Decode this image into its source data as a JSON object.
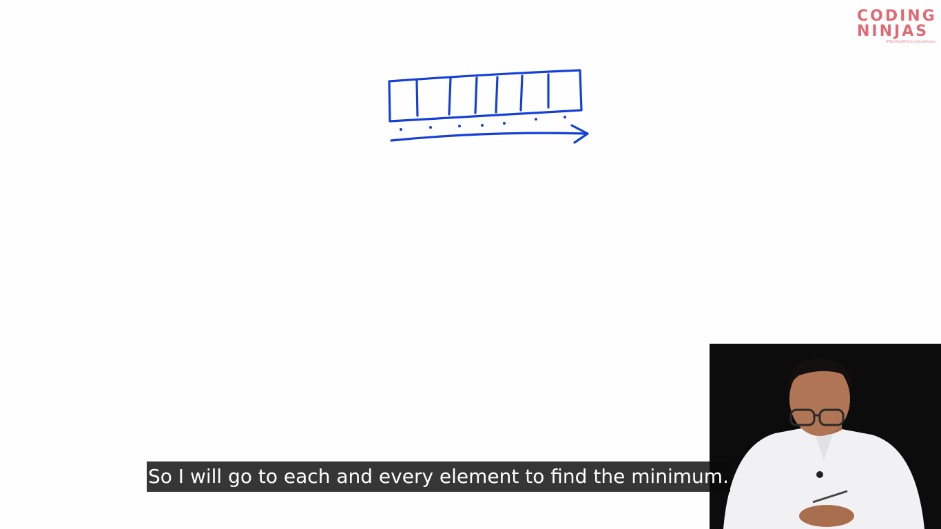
{
  "logo": {
    "line1": "CODING",
    "line2": "NINJAS",
    "tagline": "#SkillUpWithCodingNinjas",
    "color": "#e06a73"
  },
  "drawing": {
    "ink_color": "#1440d8",
    "description_icon": "array-drawing-icon"
  },
  "webcam": {
    "background": "#0c0c0c"
  },
  "subtitle": {
    "text": "So I will go to each and every element to find the minimum."
  }
}
